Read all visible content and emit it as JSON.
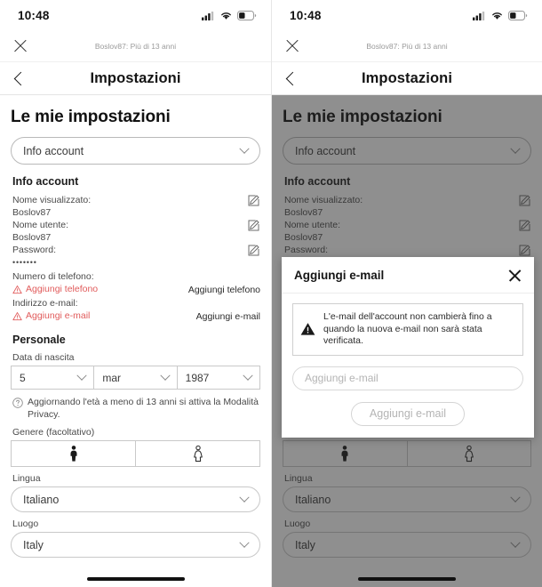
{
  "status_bar": {
    "time": "10:48",
    "icons": [
      "cellular-signal-icon",
      "wifi-icon",
      "battery-icon"
    ]
  },
  "top_bar": {
    "close_icon": "close-icon",
    "subtitle": "Boslov87: Più di 13 anni"
  },
  "nav": {
    "back_icon": "chevron-left-icon",
    "title": "Impostazioni"
  },
  "page": {
    "title": "Le mie impostazioni",
    "category_select": {
      "value": "Info account",
      "chevron_icon": "chevron-down-icon"
    },
    "account_section": {
      "heading": "Info account",
      "rows": [
        {
          "label": "Nome visualizzato:",
          "value": "Boslov87",
          "action_icon": "edit-icon"
        },
        {
          "label": "Nome utente:",
          "value": "Boslov87",
          "action_icon": "edit-icon"
        },
        {
          "label": "Password:",
          "value": "•••••••",
          "action_icon": "edit-icon"
        }
      ],
      "phone": {
        "label": "Numero di telefono:",
        "alert_text": "Aggiungi telefono",
        "alert_icon": "warning-triangle-icon",
        "action_label": "Aggiungi telefono"
      },
      "email": {
        "label": "Indirizzo e-mail:",
        "alert_text": "Aggiungi e-mail",
        "alert_icon": "warning-triangle-icon",
        "action_label": "Aggiungi e-mail"
      }
    },
    "personal_section": {
      "heading": "Personale",
      "birthdate_label": "Data di nascita",
      "birthdate": {
        "day": "5",
        "month": "mar",
        "year": "1987"
      },
      "privacy_note": {
        "icon": "question-circle-icon",
        "text": "Aggiornando l'età a meno di 13 anni si attiva la Modalità Privacy."
      },
      "gender_label": "Genere (facoltativo)",
      "gender_options": [
        {
          "icon": "male-gender-icon"
        },
        {
          "icon": "female-gender-icon"
        }
      ],
      "language_label": "Lingua",
      "language_value": "Italiano",
      "location_label": "Luogo",
      "location_value": "Italy"
    }
  },
  "modal": {
    "title": "Aggiungi e-mail",
    "close_icon": "close-icon",
    "warning": {
      "icon": "warning-triangle-filled-icon",
      "text": "L'e-mail dell'account non cambierà fino a quando la nuova e-mail non sarà stata verificata."
    },
    "input_placeholder": "Aggiungi e-mail",
    "submit_label": "Aggiungi e-mail"
  },
  "colors": {
    "alert_red": "#e15b5b",
    "text_primary": "#161616",
    "text_secondary": "#4a4a4a",
    "border": "#c9c9c9",
    "overlay": "rgba(40,40,40,0.52)"
  }
}
